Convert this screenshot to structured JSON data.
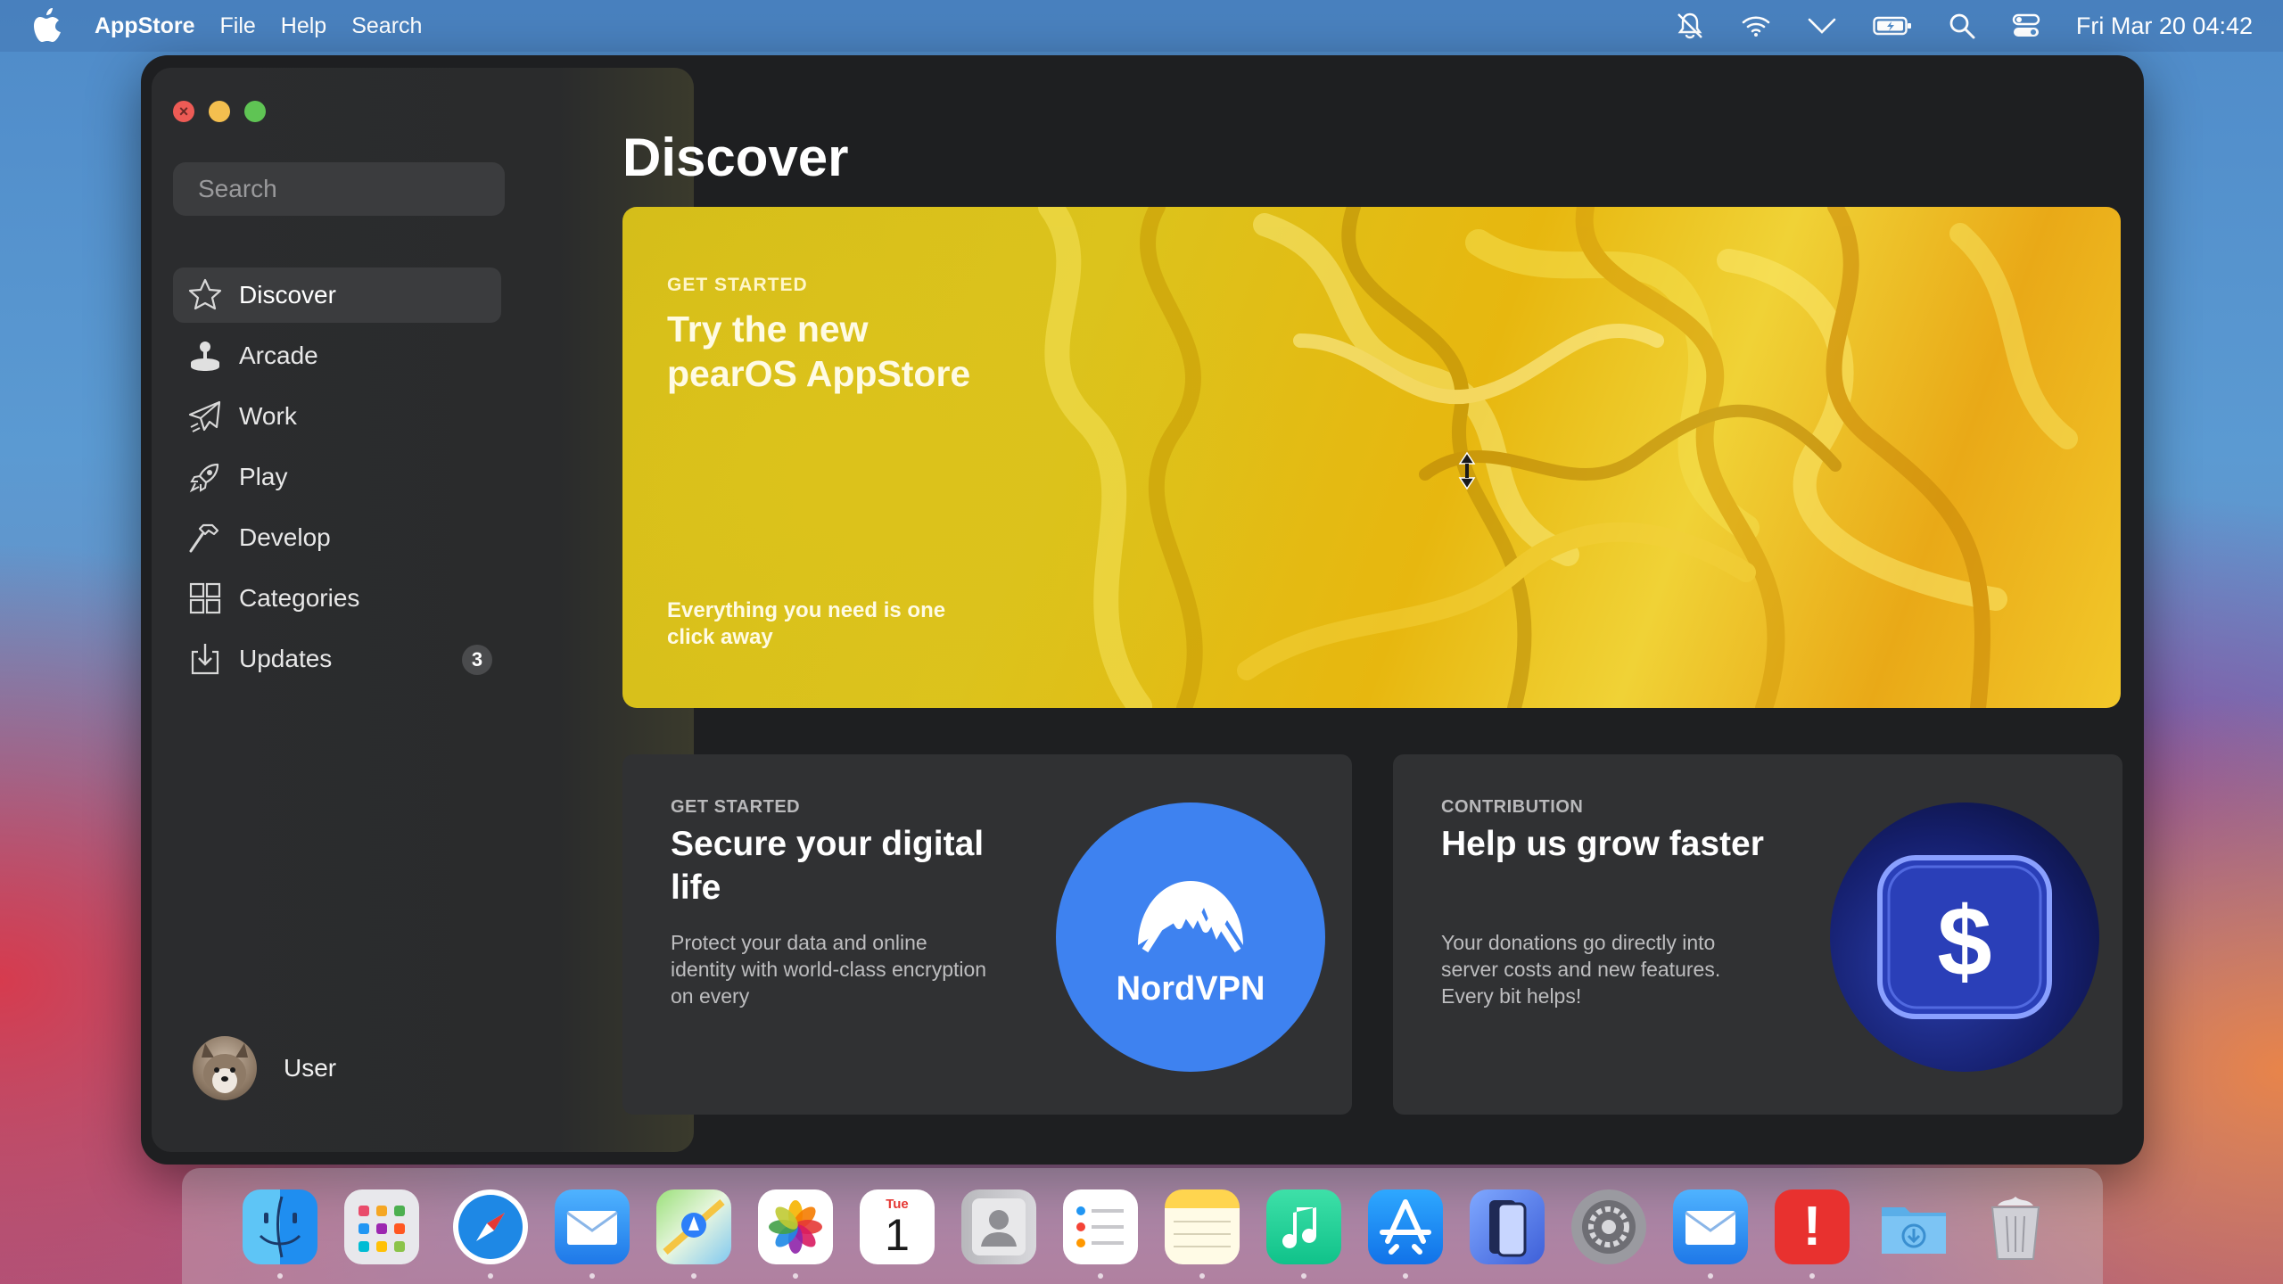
{
  "menubar": {
    "app_name": "AppStore",
    "menus": [
      "File",
      "Help",
      "Search"
    ],
    "status_icons": [
      "notifications-off-icon",
      "wifi-icon",
      "chevron-down-icon",
      "battery-icon",
      "search-icon",
      "control-center-icon"
    ],
    "clock": "Fri Mar 20 04:42"
  },
  "sidebar": {
    "search_placeholder": "Search",
    "items": [
      {
        "label": "Discover",
        "icon": "star-icon",
        "active": true
      },
      {
        "label": "Arcade",
        "icon": "joystick-icon"
      },
      {
        "label": "Work",
        "icon": "paper-plane-icon"
      },
      {
        "label": "Play",
        "icon": "rocket-icon"
      },
      {
        "label": "Develop",
        "icon": "hammer-icon"
      },
      {
        "label": "Categories",
        "icon": "grid-icon"
      },
      {
        "label": "Updates",
        "icon": "download-icon",
        "badge": "3"
      }
    ],
    "user": {
      "name": "User"
    }
  },
  "main": {
    "title": "Discover",
    "hero": {
      "eyebrow": "GET STARTED",
      "headline": "Try the new pearOS AppStore",
      "subtitle": "Everything you need is one click away"
    },
    "cards": [
      {
        "eyebrow": "GET STARTED",
        "headline": "Secure your digital life",
        "description": "Protect your data and online identity with world-class encryption on every",
        "logo_text": "NordVPN"
      },
      {
        "eyebrow": "CONTRIBUTION",
        "headline": "Help us grow faster",
        "description": "Your donations go directly into server costs and new features. Every bit helps!",
        "logo_text": "$"
      }
    ]
  },
  "dock": {
    "apps": [
      "finder-icon",
      "launchpad-icon",
      "safari-icon",
      "mail-icon",
      "maps-icon",
      "photos-icon",
      "calendar-icon",
      "contacts-icon",
      "reminders-icon",
      "notes-icon",
      "music-icon",
      "appstore-icon",
      "iphone-mirroring-icon",
      "system-settings-icon",
      "mail-alt-icon",
      "alert-icon",
      "downloads-folder-icon",
      "trash-icon"
    ],
    "calendar": {
      "month": "Tue",
      "day": "1"
    },
    "alert_glyph": "!"
  },
  "colors": {
    "window_bg": "#1e1f21",
    "sidebar_active": "#3b3c3e",
    "hero_yellow": "#e7b70f",
    "nord_blue": "#3e82f0"
  }
}
